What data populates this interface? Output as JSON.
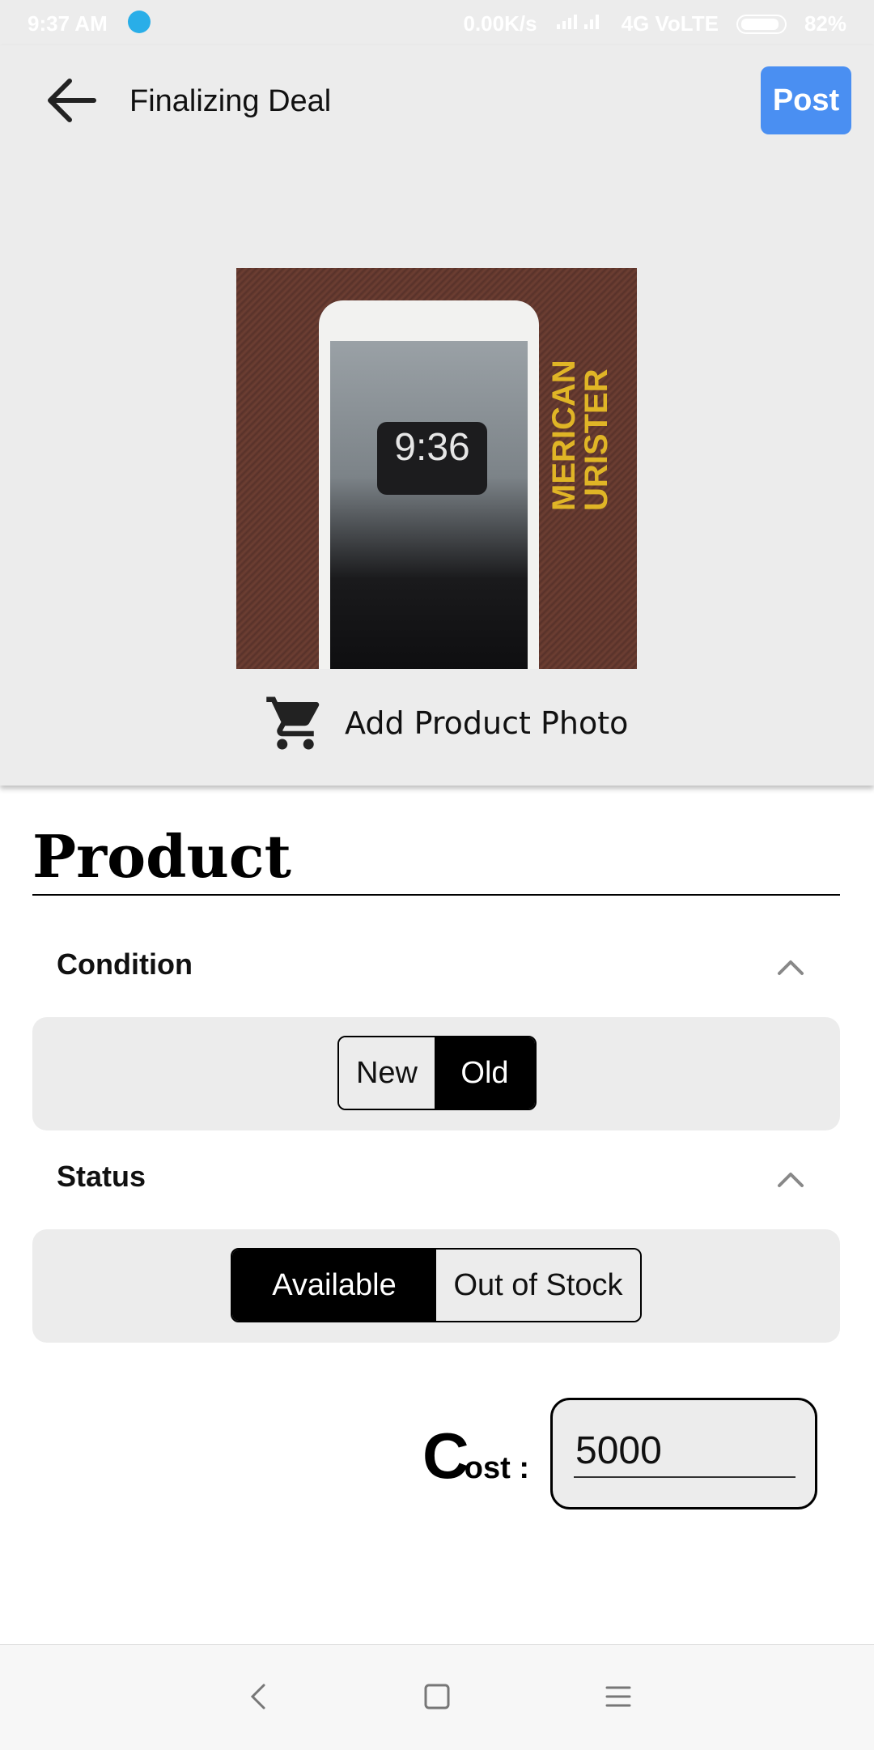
{
  "status_bar": {
    "time": "9:37 AM",
    "net_speed": "0.00K/s",
    "network": "4G VoLTE",
    "battery": "82%"
  },
  "header": {
    "title": "Finalizing Deal",
    "post_label": "Post"
  },
  "product_photo": {
    "clock_text": "9:36",
    "brand_text": "MERICAN\nURISTER"
  },
  "add_photo_label": "Add Product Photo",
  "section_title": "Product",
  "condition": {
    "label": "Condition",
    "options": [
      "New",
      "Old"
    ],
    "selected": "Old"
  },
  "status": {
    "label": "Status",
    "options": [
      "Available",
      "Out of Stock"
    ],
    "selected": "Available"
  },
  "cost": {
    "label_initial": "C",
    "label_rest": "ost :",
    "value": "5000"
  },
  "icons": {
    "back": "arrow-left-icon",
    "cart": "cart-icon",
    "chevron": "chevron-up-icon",
    "nav_back": "nav-back-icon",
    "nav_home": "nav-home-icon",
    "nav_menu": "nav-menu-icon"
  },
  "colors": {
    "accent": "#4a8ff2",
    "panel": "#ececec",
    "selected_segment": "#000000"
  }
}
